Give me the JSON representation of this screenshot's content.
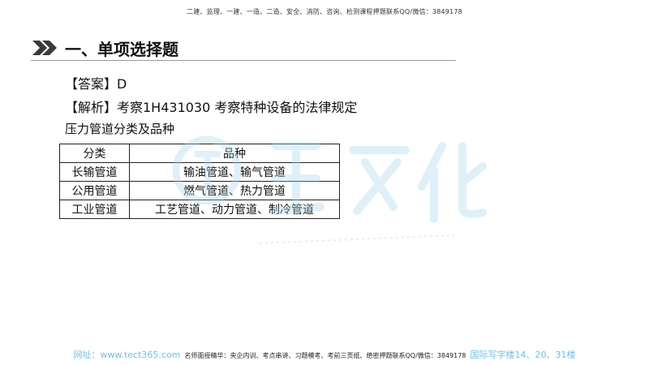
{
  "header": {
    "banner": "二建、监理、一建、一造、二造、安全、消防、咨询、检测课程押题联系QQ/微信：3849178"
  },
  "section": {
    "icon": "double-chevron-right-icon",
    "title": "一、单项选择题"
  },
  "content": {
    "answer": "【答案】D",
    "analysis": "【解析】考察1H431030 考察特种设备的法律规定",
    "subtitle": "压力管道分类及品种"
  },
  "table": {
    "headers": [
      "分类",
      "品种"
    ],
    "rows": [
      [
        "长输管道",
        "输油管道、输气管道"
      ],
      [
        "公用管道",
        "燃气管道、热力管道"
      ],
      [
        "工业管道",
        "工艺管道、动力管道、制冷管道"
      ]
    ]
  },
  "footer": {
    "site": "网址：www.tect365.com",
    "notice": "名师面授精华：央企内训、考点串讲、习题模考、考前三页纸、绝密押题联系QQ/微信：3849178",
    "address": "国际写字楼14、20、31楼"
  },
  "colors": {
    "watermark": "#a9d7ee",
    "footer_link": "#6fc0e8",
    "title_icon": "#3a3a3a"
  }
}
